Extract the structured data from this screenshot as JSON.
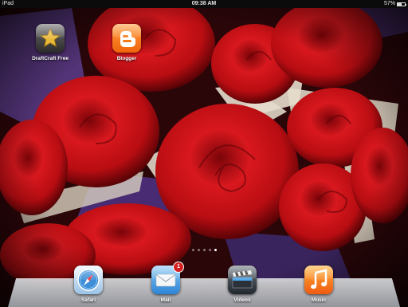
{
  "status_bar": {
    "carrier": "iPad",
    "time": "09:38 AM",
    "battery": "57%",
    "battery_level": 0.57
  },
  "home_apps": [
    {
      "label": "DraftCraft Free",
      "icon": "star-icon"
    },
    {
      "label": "Blogger",
      "icon": "blogger-icon"
    }
  ],
  "page_dots": {
    "count": 5,
    "active": 5
  },
  "dock": [
    {
      "label": "Safari",
      "icon": "safari-compass-icon"
    },
    {
      "label": "Mail",
      "icon": "mail-envelope-icon",
      "badge": "1"
    },
    {
      "label": "Videos",
      "icon": "clapperboard-icon"
    },
    {
      "label": "Music",
      "icon": "music-note-icon"
    }
  ],
  "colors": {
    "rose": "#b80d12",
    "purple": "#5a3d8c",
    "paper": "#ded6c6",
    "status_bar": "#0b0b0b"
  }
}
